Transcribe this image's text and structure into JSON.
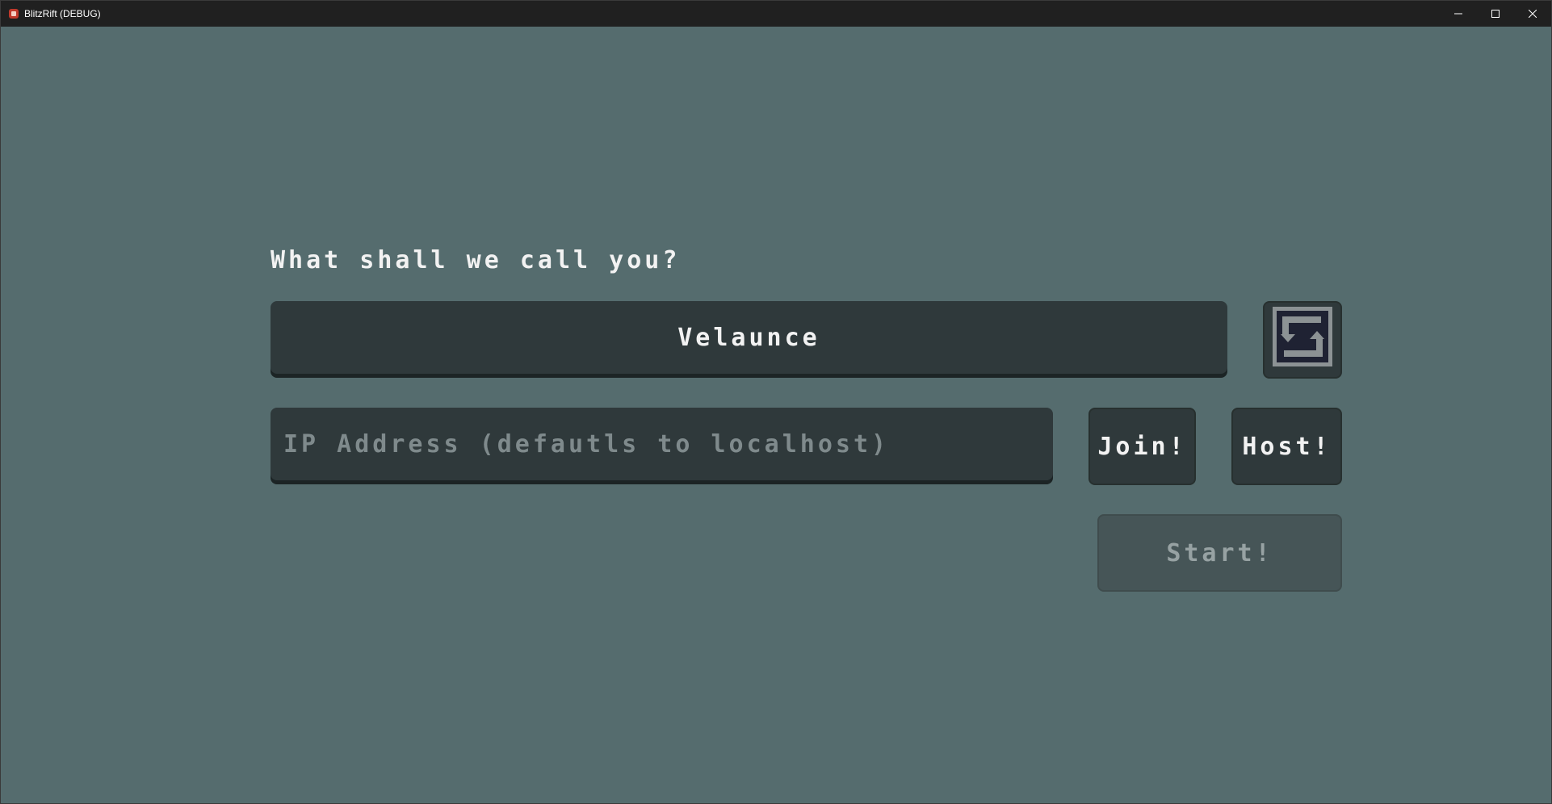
{
  "window": {
    "title": "BlitzRift (DEBUG)",
    "icon": "app-icon",
    "controls": {
      "minimize_icon": "minimize-icon",
      "maximize_icon": "maximize-icon",
      "close_icon": "close-icon"
    }
  },
  "colors": {
    "background": "#556c6e",
    "panel": "#2f393b",
    "text": "#f2f2f2",
    "placeholder": "#7f8a8c",
    "disabled_button": "#465557"
  },
  "form": {
    "prompt": "What shall we call you?",
    "name_value": "Velaunce",
    "randomize_icon": "randomize-name-icon",
    "ip_placeholder": "IP Address (defautls to localhost)",
    "join_label": "Join!",
    "host_label": "Host!",
    "start_label": "Start!"
  }
}
